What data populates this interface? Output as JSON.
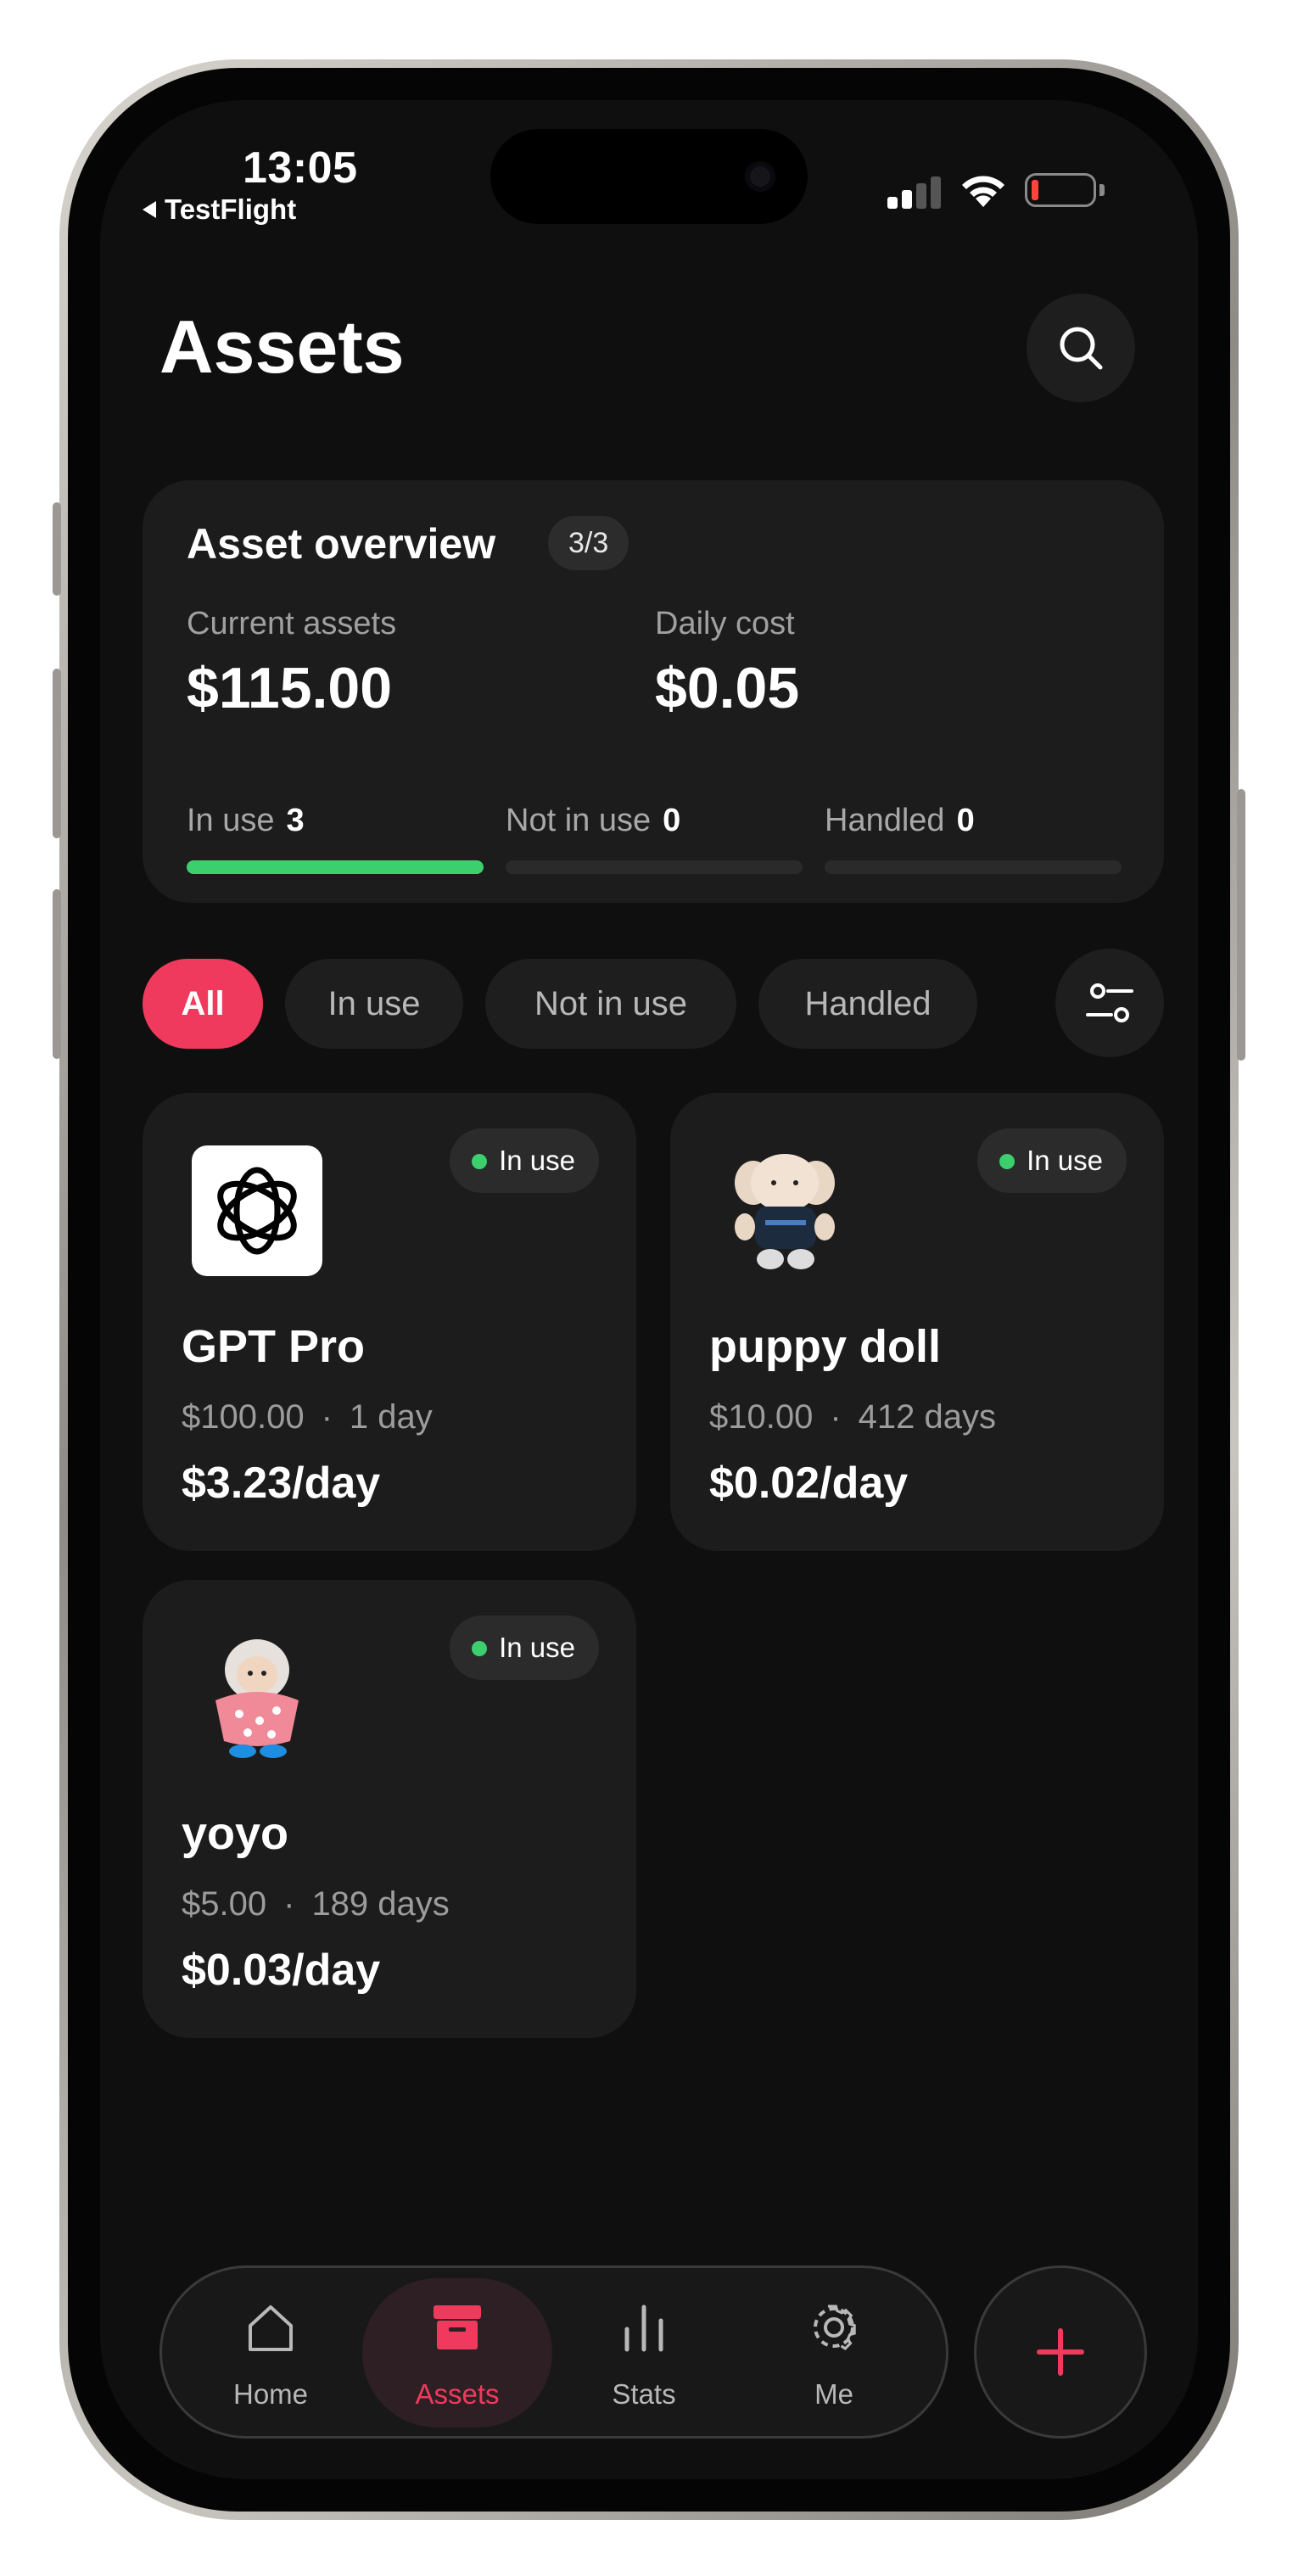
{
  "status_bar": {
    "time": "13:05",
    "back_app": "TestFlight"
  },
  "page": {
    "title": "Assets"
  },
  "overview": {
    "title": "Asset overview",
    "count_badge": "3/3",
    "current_assets_label": "Current assets",
    "current_assets_value": "$115.00",
    "daily_cost_label": "Daily cost",
    "daily_cost_value": "$0.05",
    "stats": [
      {
        "label": "In use",
        "count": "3",
        "progress": 1.0
      },
      {
        "label": "Not in use",
        "count": "0",
        "progress": 0
      },
      {
        "label": "Handled",
        "count": "0",
        "progress": 0
      }
    ]
  },
  "filters": [
    {
      "label": "All",
      "active": true
    },
    {
      "label": "In use",
      "active": false
    },
    {
      "label": "Not in use",
      "active": false
    },
    {
      "label": "Handled",
      "active": false
    }
  ],
  "assets": [
    {
      "name": "GPT Pro",
      "status": "In use",
      "price": "$100.00",
      "separator": "·",
      "duration": "1 day",
      "daily": "$3.23/day",
      "icon": "openai-logo-icon"
    },
    {
      "name": "puppy doll",
      "status": "In use",
      "price": "$10.00",
      "separator": "·",
      "duration": "412 days",
      "daily": "$0.02/day",
      "icon": "puppy-doll-image"
    },
    {
      "name": "yoyo",
      "status": "In use",
      "price": "$5.00",
      "separator": "·",
      "duration": "189 days",
      "daily": "$0.03/day",
      "icon": "yoyo-doll-image"
    }
  ],
  "tabbar": {
    "tabs": [
      {
        "label": "Home",
        "icon": "home-icon",
        "active": false
      },
      {
        "label": "Assets",
        "icon": "archive-box-icon",
        "active": true
      },
      {
        "label": "Stats",
        "icon": "bar-chart-icon",
        "active": false
      },
      {
        "label": "Me",
        "icon": "gear-icon",
        "active": false
      }
    ],
    "add_icon": "plus-icon"
  },
  "colors": {
    "accent": "#ef3a5d",
    "in_use_green": "#3ccf6e",
    "background": "#0f0f0f",
    "card": "#1c1c1c"
  }
}
